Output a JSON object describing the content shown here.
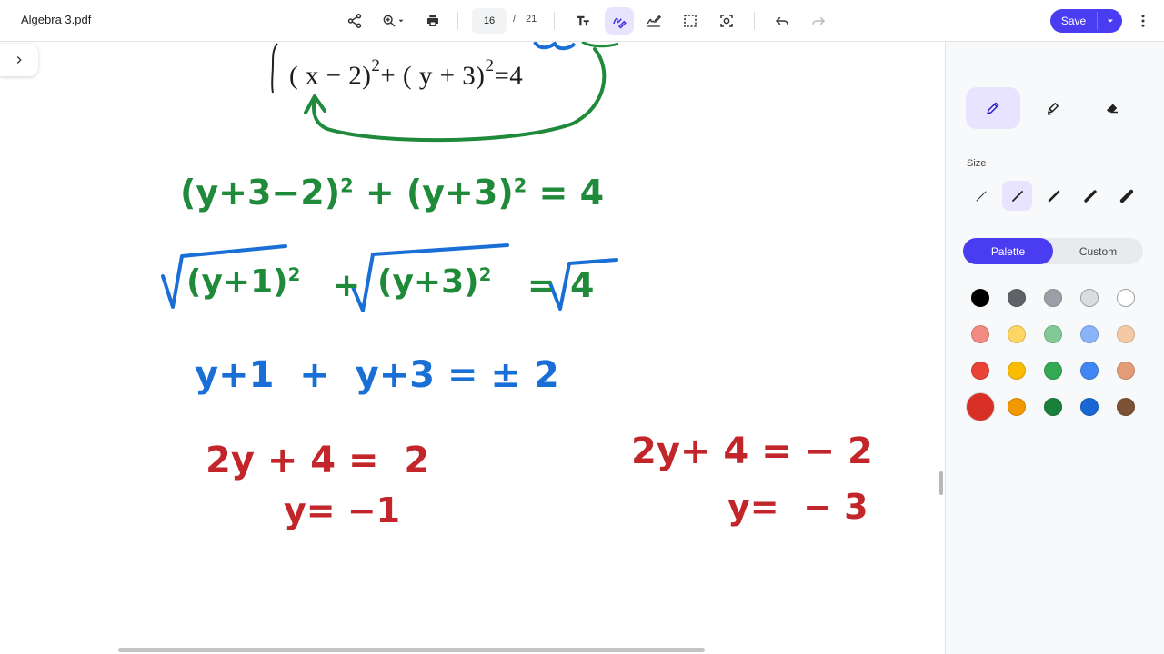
{
  "app": {
    "doc_title": "Algebra 3.pdf",
    "page_current": "16",
    "page_separator": "/",
    "page_total": "21",
    "save_label": "Save"
  },
  "toolbar_icons": [
    "share-icon",
    "zoom-icon",
    "print-icon",
    "text-icon",
    "draw-icon",
    "signature-icon",
    "select-icon",
    "lens-icon",
    "undo-icon",
    "redo-icon",
    "more-icon"
  ],
  "document": {
    "equation": {
      "a": "( x − 2)",
      "p1": "2",
      "b": "+ ( y + 3)",
      "p2": "2",
      "c": "=4"
    },
    "step1": {
      "a": "(y+3−2)",
      "p1": "2",
      "b": " + (y+3)",
      "p2": "2",
      "c": " = 4"
    },
    "step2": {
      "a": "(y+1)",
      "p1": "2",
      "b": "+",
      "c": "(y+3)",
      "p2": "2",
      "d": "=",
      "e": "4"
    },
    "step3": "y+1  +  y+3 = ± 2",
    "case1": {
      "line1": "2y + 4 =  2",
      "line2": "y= −1"
    },
    "case2": {
      "line1": "2y+ 4 = − 2",
      "line2": "y=  − 3"
    }
  },
  "panel": {
    "size_label": "Size",
    "tab_palette": "Palette",
    "tab_custom": "Custom",
    "tools": [
      "pen-icon",
      "highlighter-icon",
      "eraser-icon"
    ],
    "active_tool": "pen",
    "stroke_sizes": [
      1,
      2,
      3,
      4,
      5
    ],
    "active_size_index": 1,
    "palette": [
      [
        "#000000",
        "#5f6368",
        "#9aa0a6",
        "#dadce0",
        "#ffffff"
      ],
      [
        "#f28b82",
        "#fdd663",
        "#81c995",
        "#8ab4f8",
        "#f4c9a6"
      ],
      [
        "#ea4335",
        "#fbbc04",
        "#34a853",
        "#4285f4",
        "#e39b78"
      ],
      [
        "#d93025",
        "#f29900",
        "#188038",
        "#1967d2",
        "#7c5136"
      ]
    ],
    "selected_color": "#d93025"
  }
}
